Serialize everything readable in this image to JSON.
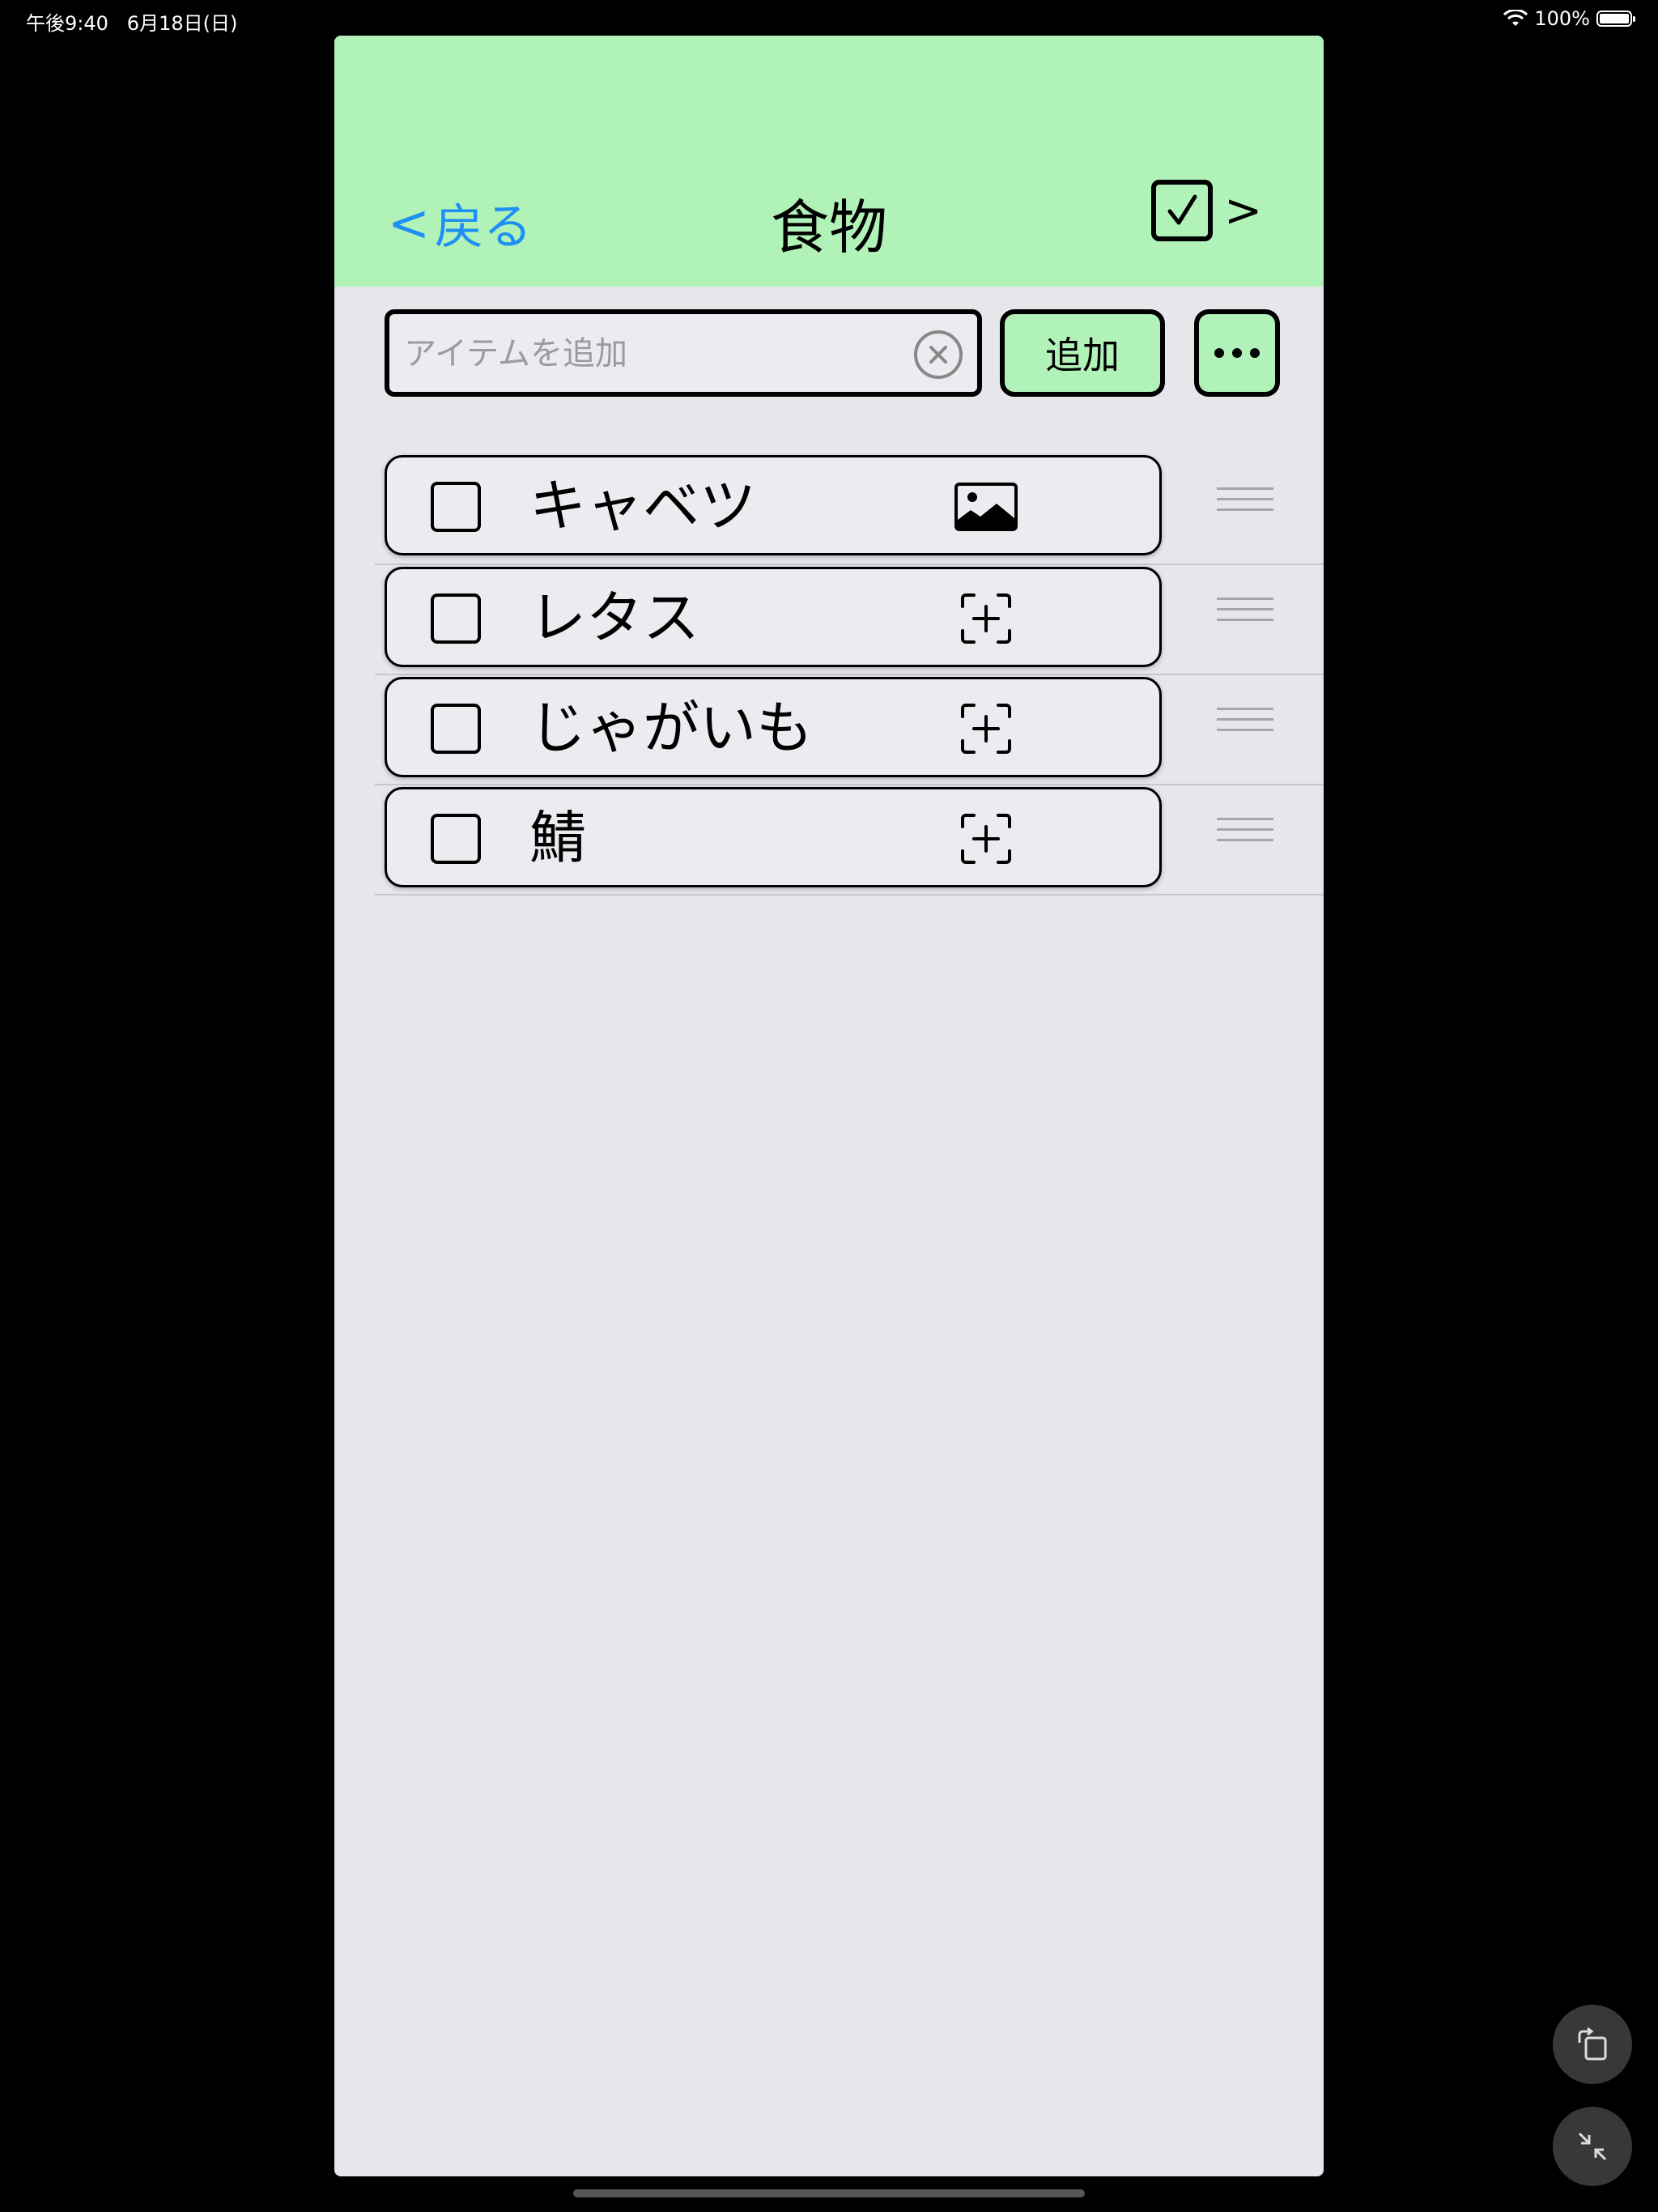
{
  "status": {
    "time": "午後9:40",
    "date": "6月18日(日)",
    "battery": "100%",
    "battery_level": 1.0
  },
  "header": {
    "back_label": "戻る",
    "back_chevron": "<",
    "title": "食物",
    "check_all_arrow": ">"
  },
  "input": {
    "placeholder": "アイテムを追加",
    "value": "",
    "add_label": "追加"
  },
  "items": [
    {
      "name": "キャベツ",
      "checked": false,
      "photo_icon": "photo-icon"
    },
    {
      "name": "レタス",
      "checked": false,
      "photo_icon": "add-photo-icon"
    },
    {
      "name": "じゃがいも",
      "checked": false,
      "photo_icon": "add-photo-icon"
    },
    {
      "name": "鯖",
      "checked": false,
      "photo_icon": "add-photo-icon"
    }
  ],
  "colors": {
    "header_bg": "#b1f2b8",
    "content_bg": "#e6e6eb",
    "accent_link": "#1e8ff5"
  }
}
